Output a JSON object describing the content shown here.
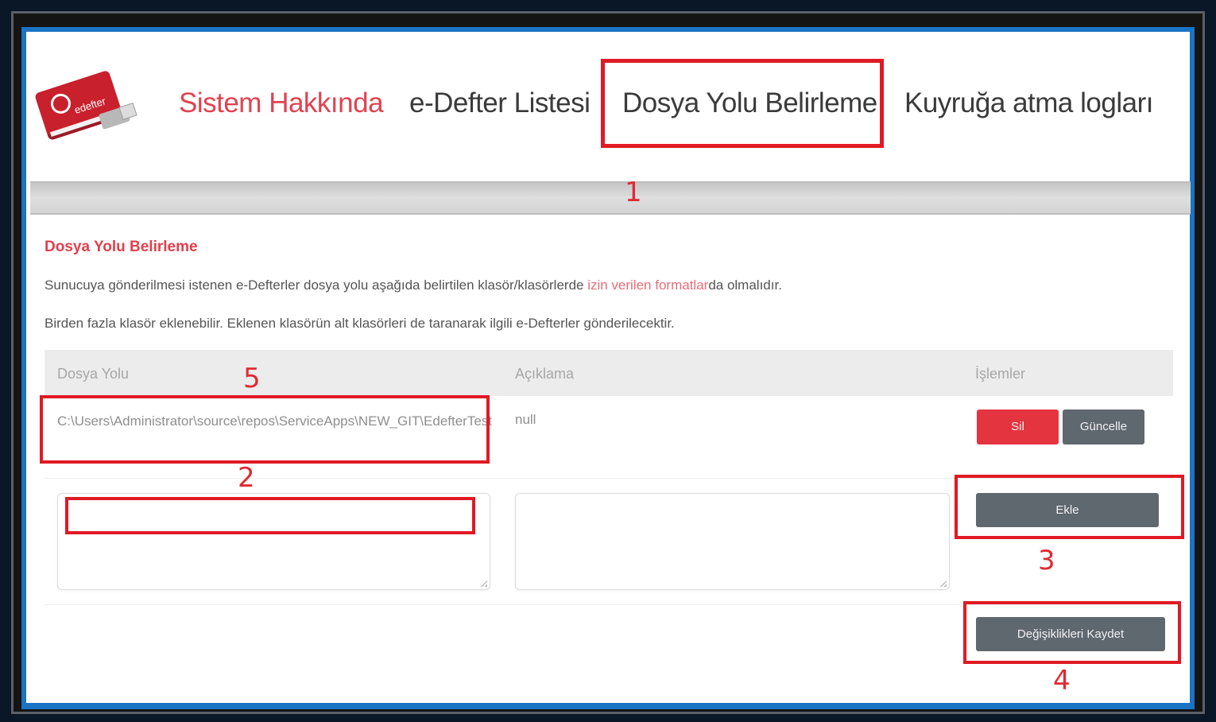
{
  "nav": {
    "items": [
      {
        "label": "Sistem Hakkında"
      },
      {
        "label": "e-Defter Listesi"
      },
      {
        "label": "Dosya Yolu Belirleme"
      },
      {
        "label": "Kuyruğa atma logları"
      }
    ]
  },
  "logo": {
    "text": "edefter"
  },
  "section": {
    "title": "Dosya Yolu Belirleme",
    "para1_before": "Sunucuya gönderilmesi istenen e-Defterler dosya yolu aşağıda belirtilen klasör/klasörlerde ",
    "para1_link": "izin verilen formatlar",
    "para1_after": "da olmalıdır.",
    "para2": "Birden fazla klasör eklenebilir. Eklenen klasörün alt klasörleri de taranarak ilgili e-Defterler gönderilecektir."
  },
  "table": {
    "headers": {
      "path": "Dosya Yolu",
      "desc": "Açıklama",
      "ops": "İşlemler"
    },
    "rows": [
      {
        "path": "C:\\Users\\Administrator\\source\\repos\\ServiceApps\\NEW_GIT\\EdefterTest",
        "desc": "null"
      }
    ]
  },
  "buttons": {
    "delete": "Sil",
    "update": "Güncelle",
    "add": "Ekle",
    "save": "Değişiklikleri Kaydet"
  },
  "annotations": {
    "n1": "1",
    "n2": "2",
    "n3": "3",
    "n4": "4",
    "n5": "5",
    "color": "#e01a24"
  },
  "colors": {
    "accent": "#e0404d",
    "danger_button": "#e4343f",
    "neutral_button": "#5f676f",
    "frame_blue": "#1b73c4"
  }
}
